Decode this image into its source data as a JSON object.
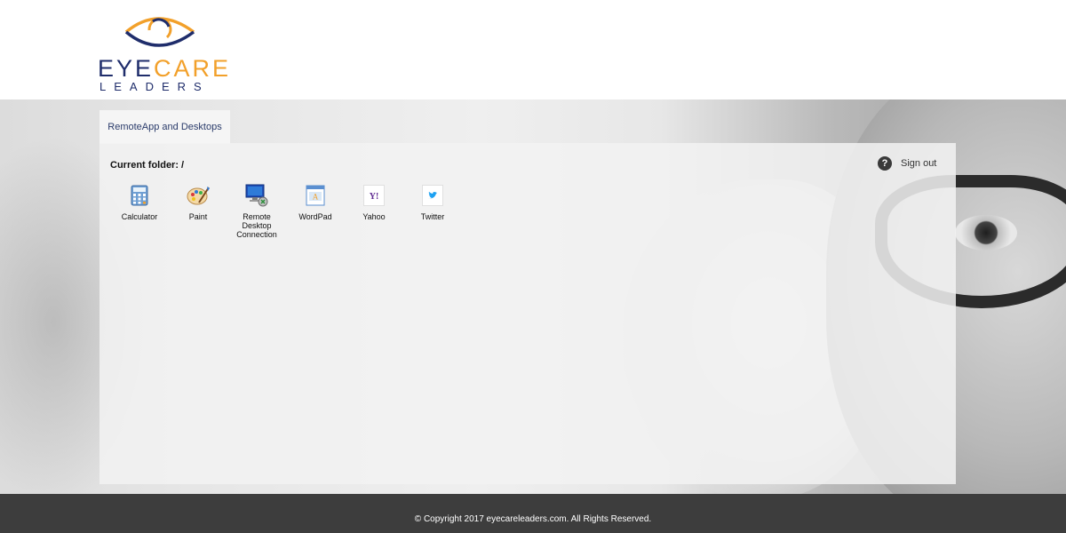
{
  "logo": {
    "word1_blue": "EYE",
    "word1_orange": "CARE",
    "word2": "LEADERS"
  },
  "tab": {
    "label": "RemoteApp and Desktops"
  },
  "panel": {
    "current_folder": "Current folder: /",
    "help_glyph": "?",
    "signout_label": "Sign out"
  },
  "apps": [
    {
      "label": "Calculator",
      "icon": "calculator-icon"
    },
    {
      "label": "Paint",
      "icon": "paint-icon"
    },
    {
      "label": "Remote Desktop Connection",
      "icon": "remote-desktop-icon"
    },
    {
      "label": "WordPad",
      "icon": "wordpad-icon"
    },
    {
      "label": "Yahoo",
      "icon": "yahoo-icon",
      "glyph": "Y!"
    },
    {
      "label": "Twitter",
      "icon": "twitter-icon"
    }
  ],
  "footer": {
    "copyright": "© Copyright 2017 eyecareleaders.com. All Rights Reserved."
  },
  "colors": {
    "brand_blue": "#1f2d6b",
    "brand_orange": "#f2a02a",
    "footer_bg": "#3d3d3d"
  }
}
